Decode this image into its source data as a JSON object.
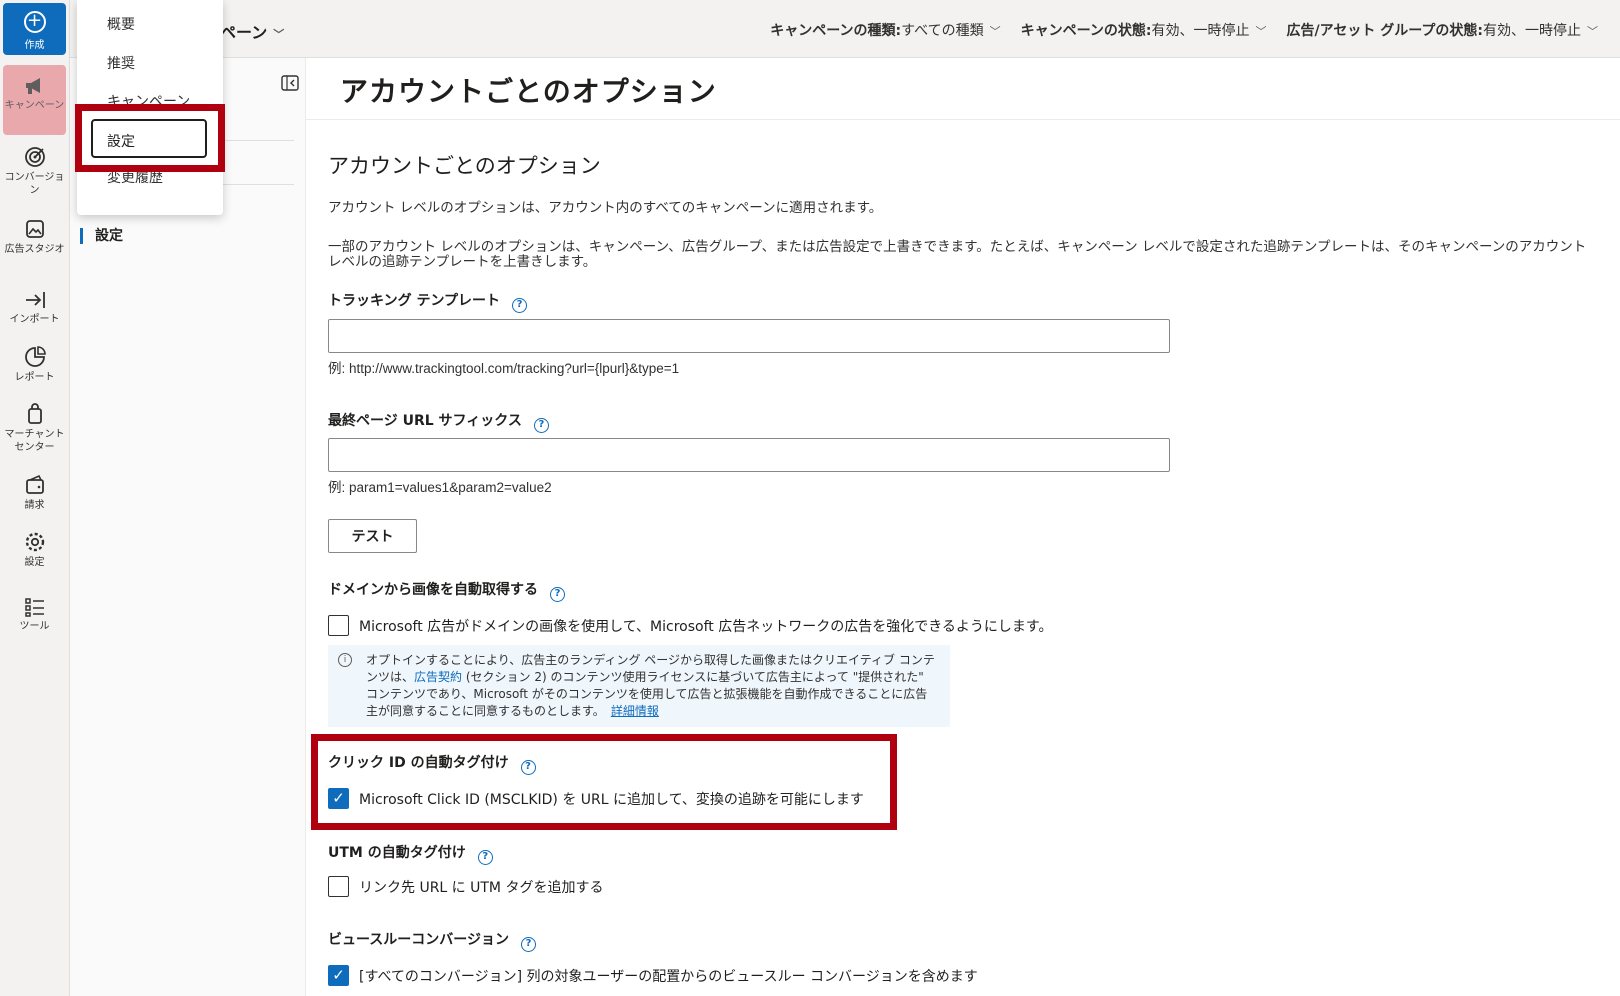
{
  "rail": {
    "create": "作成",
    "items": [
      "キャンペーン",
      "コンバージョン",
      "広告スタジオ",
      "インポート",
      "レポート",
      "マーチャント センター",
      "請求",
      "設定",
      "ツール"
    ]
  },
  "topbar": {
    "crumb": "ペーン",
    "filters": [
      {
        "key": "キャンペーンの種類:",
        "value": "すべての種類"
      },
      {
        "key": "キャンペーンの状態:",
        "value": "有効、一時停止"
      },
      {
        "key": "広告/アセット グループの状態:",
        "value": "有効、一時停止"
      }
    ]
  },
  "menu": {
    "items": [
      "概要",
      "推奨",
      "キャンペーン",
      "設定",
      "変更履歴"
    ],
    "selected": "設定"
  },
  "subnav": {
    "active": "設定"
  },
  "main": {
    "page_title": "アカウントごとのオプション",
    "section_title": "アカウントごとのオプション",
    "para1": "アカウント レベルのオプションは、アカウント内のすべてのキャンペーンに適用されます。",
    "para2": "一部のアカウント レベルのオプションは、キャンペーン、広告グループ、または広告設定で上書きできます。たとえば、キャンペーン レベルで設定された追跡テンプレートは、そのキャンペーンのアカウント レベルの追跡テンプレートを上書きします。",
    "tracking_label": "トラッキング テンプレート",
    "tracking_value": "",
    "tracking_hint": "例: http://www.trackingtool.com/tracking?url={lpurl}&type=1",
    "suffix_label": "最終ページ URL サフィックス",
    "suffix_value": "",
    "suffix_hint": "例: param1=values1&param2=value2",
    "test_button": "テスト",
    "domain_label": "ドメインから画像を自動取得する",
    "domain_checkbox": "Microsoft 広告がドメインの画像を使用して、Microsoft 広告ネットワークの広告を強化できるようにします。",
    "info_pre": "オプトインすることにより、広告主のランディング ページから取得した画像またはクリエイティブ コンテンツは、",
    "info_link1": "広告契約",
    "info_post": " (セクション 2) のコンテンツ使用ライセンスに基づいて広告主によって \"提供された\" コンテンツであり、Microsoft がそのコンテンツを使用して広告と拡張機能を自動作成できることに広告主が同意することに同意するものとします。",
    "info_link2": "詳細情報",
    "click_label": "クリック ID の自動タグ付け",
    "click_checkbox": "Microsoft Click ID (MSCLKID) を URL に追加して、変換の追跡を可能にします",
    "click_checked": true,
    "utm_label": "UTM の自動タグ付け",
    "utm_checkbox": "リンク先 URL に UTM タグを追加する",
    "utm_checked": false,
    "vt_label": "ビュースルーコンバージョン",
    "vt_checkbox": "[すべてのコンバージョン] 列の対象ユーザーの配置からのビュースルー コンバージョンを含めます",
    "vt_checked": true
  },
  "colors": {
    "accent": "#0f6cbd",
    "highlight": "#b00010",
    "active_rail": "#e8a8ac"
  }
}
